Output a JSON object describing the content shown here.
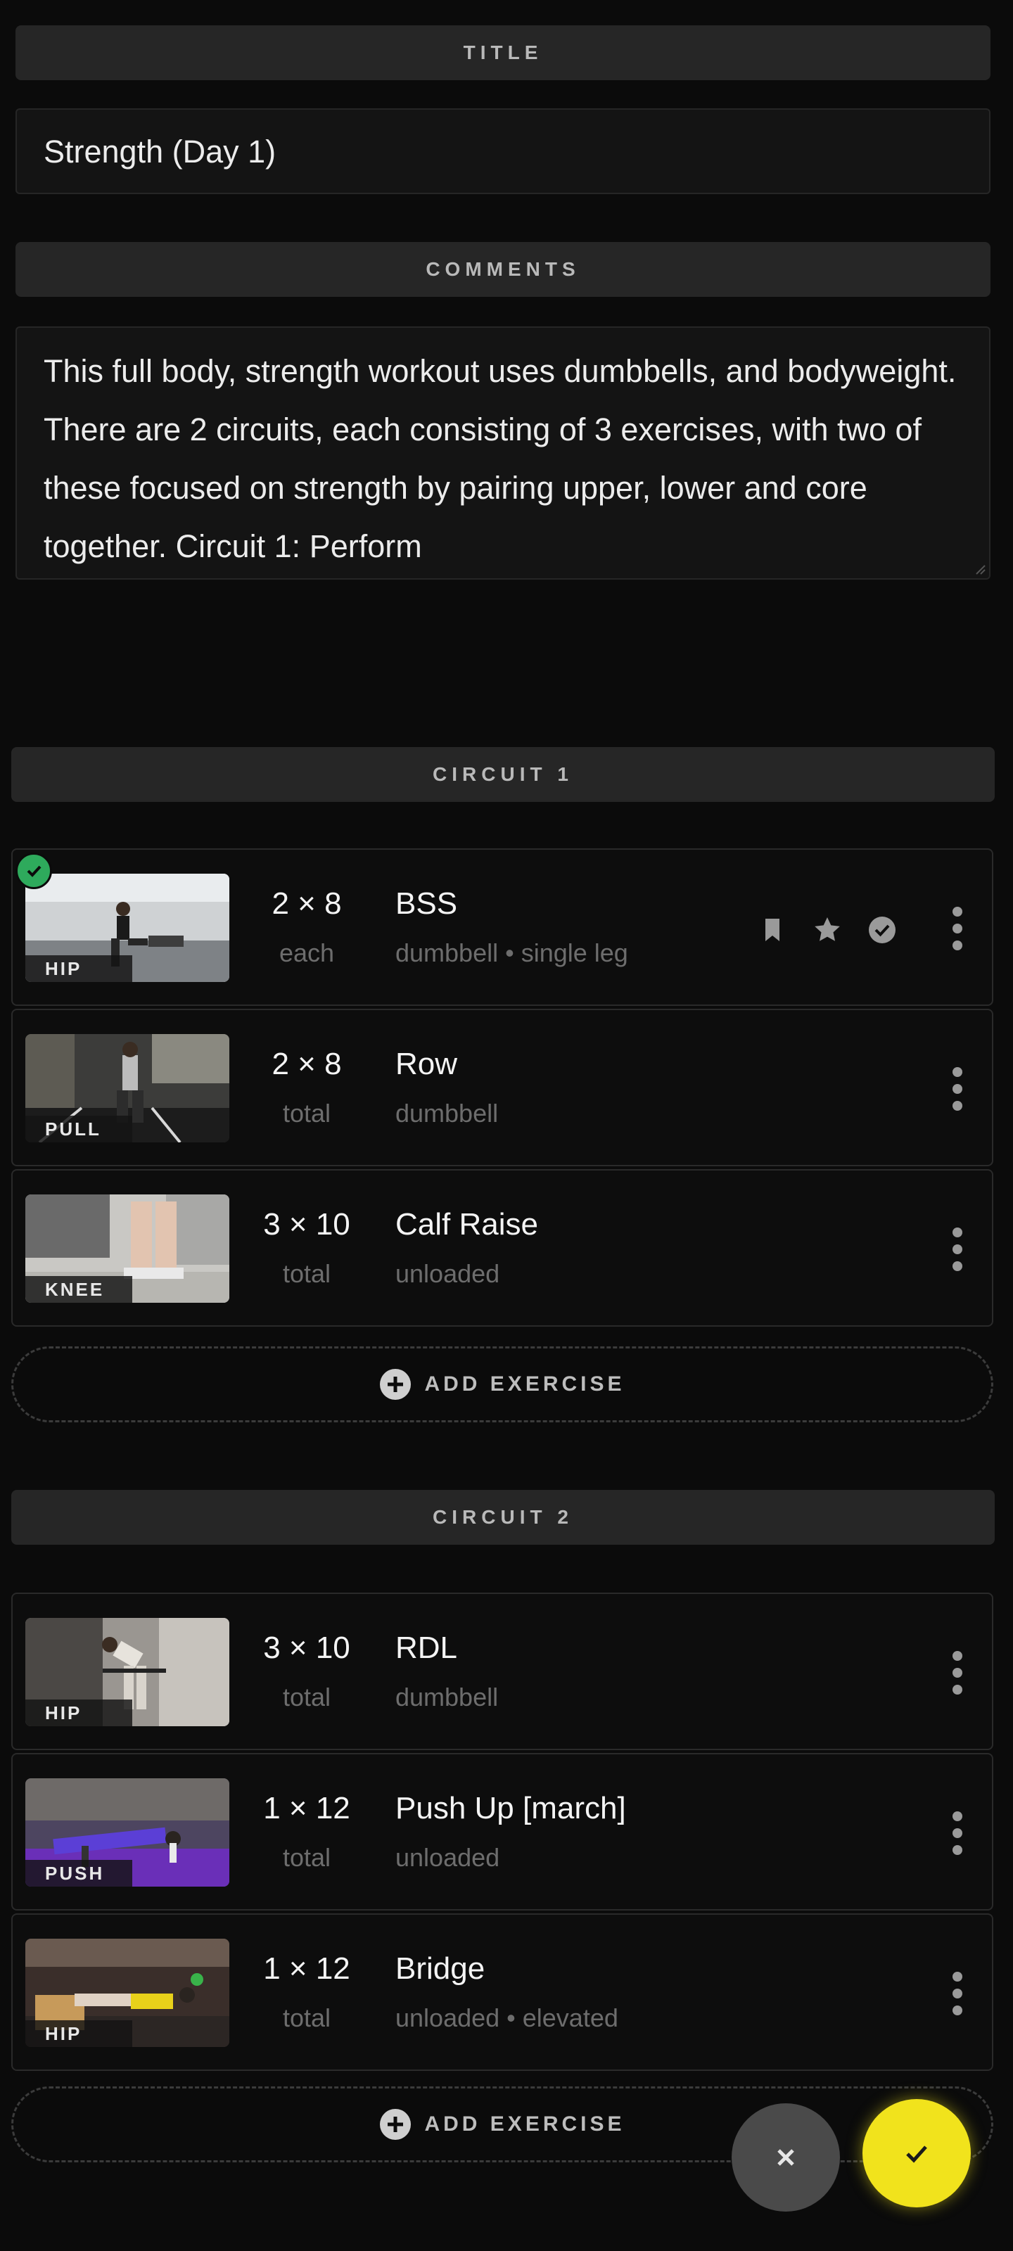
{
  "title_section": {
    "label": "TITLE",
    "value": "Strength (Day 1)"
  },
  "comments_section": {
    "label": "COMMENTS",
    "value": "This full body, strength workout uses dumbbells, and bodyweight. There are 2 circuits, each consisting of 3 exercises, with two of these focused on strength by pairing upper, lower and core together. Circuit 1: Perform"
  },
  "circuits": [
    {
      "label": "CIRCUIT 1",
      "exercises": [
        {
          "tag": "HIP",
          "sets": "2 × 8",
          "unit": "each",
          "name": "BSS",
          "meta": "dumbbell • single leg",
          "completed": true
        },
        {
          "tag": "PULL",
          "sets": "2 × 8",
          "unit": "total",
          "name": "Row",
          "meta": "dumbbell"
        },
        {
          "tag": "KNEE",
          "sets": "3 × 10",
          "unit": "total",
          "name": "Calf Raise",
          "meta": "unloaded"
        }
      ],
      "add_label": "ADD EXERCISE"
    },
    {
      "label": "CIRCUIT 2",
      "exercises": [
        {
          "tag": "HIP",
          "sets": "3 × 10",
          "unit": "total",
          "name": "RDL",
          "meta": "dumbbell"
        },
        {
          "tag": "PUSH",
          "sets": "1 × 12",
          "unit": "total",
          "name": "Push Up [march]",
          "meta": "unloaded"
        },
        {
          "tag": "HIP",
          "sets": "1 × 12",
          "unit": "total",
          "name": "Bridge",
          "meta": "unloaded • elevated"
        }
      ],
      "add_label": "ADD EXERCISE"
    }
  ],
  "icons": {
    "row_actions": [
      "bookmark-icon",
      "star-icon",
      "check-circle-icon"
    ],
    "more": "more-vertical-icon",
    "add": "plus-circle-icon",
    "cancel": "close-icon",
    "confirm": "check-icon"
  },
  "colors": {
    "background": "#0b0b0b",
    "accent": "#f1e31c",
    "success": "#2eaa5c",
    "muted": "#6d6d6d"
  }
}
